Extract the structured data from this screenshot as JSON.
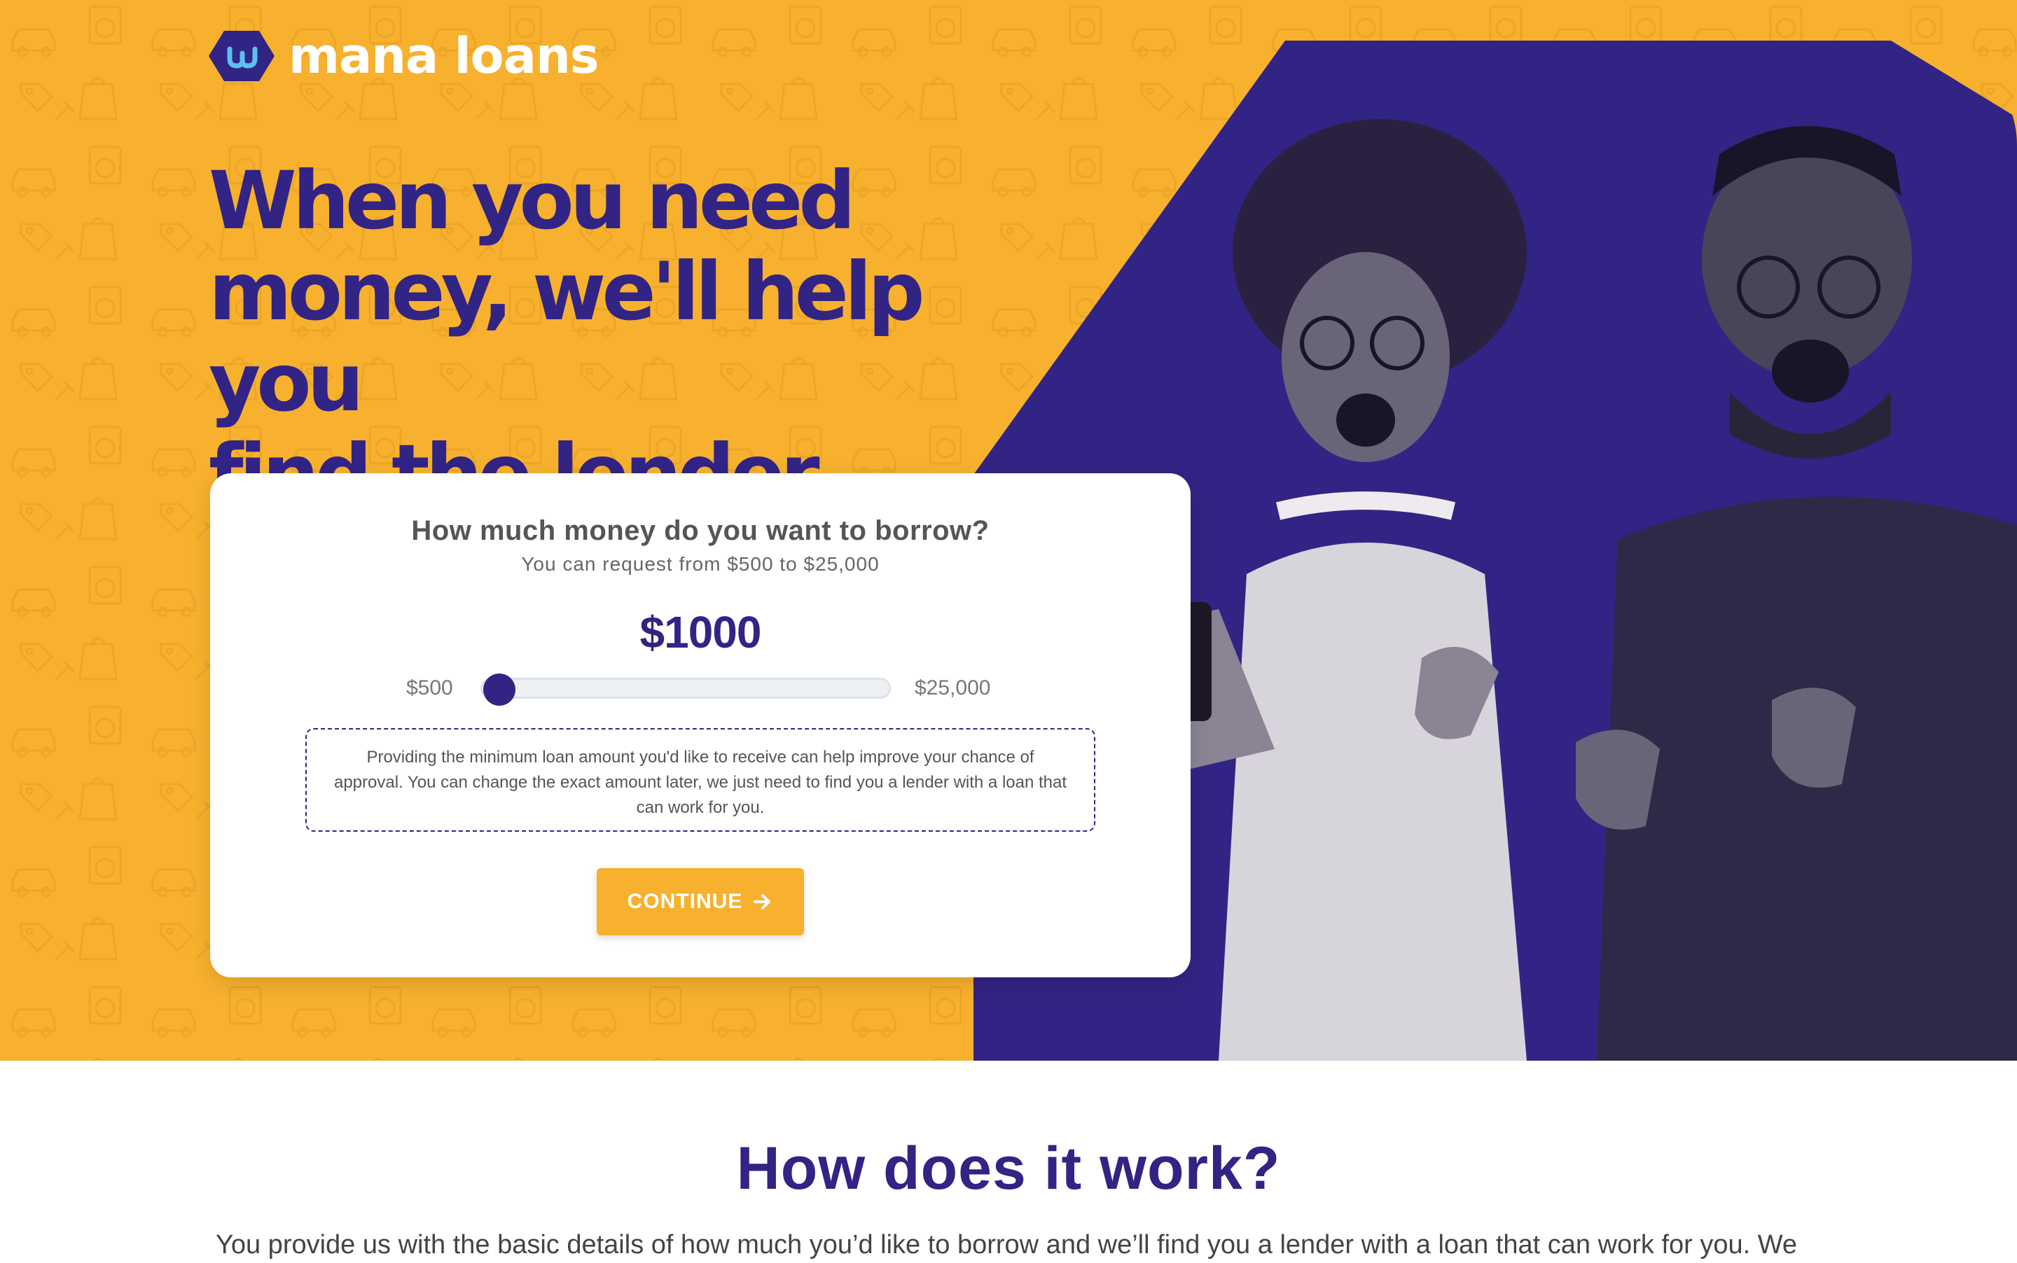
{
  "brand": {
    "name": "mana loans",
    "colors": {
      "yellow": "#f7b12f",
      "purple": "#322484",
      "light_blue": "#5bc0ef"
    }
  },
  "hero": {
    "headline": [
      "When you need",
      "money, we'll help you",
      "find the lender"
    ]
  },
  "loan_form": {
    "question": "How much money do you want to borrow?",
    "subtitle": "You can request from $500 to $25,000",
    "amount_display": "$1000",
    "slider": {
      "min_label": "$500",
      "max_label": "$25,000",
      "min": 500,
      "max": 25000,
      "value": 1000
    },
    "note": "Providing the minimum loan amount you'd like to receive can help improve your chance of approval. You can change the exact amount later, we just need to find you a lender with a loan that can work for you.",
    "continue_label": "CONTINUE",
    "continue_icon": "arrow-right-icon"
  },
  "how_it_works": {
    "title": "How does it work?",
    "text": "You provide us with the basic details of how much you’d like to borrow and we’ll find you a lender with a loan that can work for you. We"
  }
}
